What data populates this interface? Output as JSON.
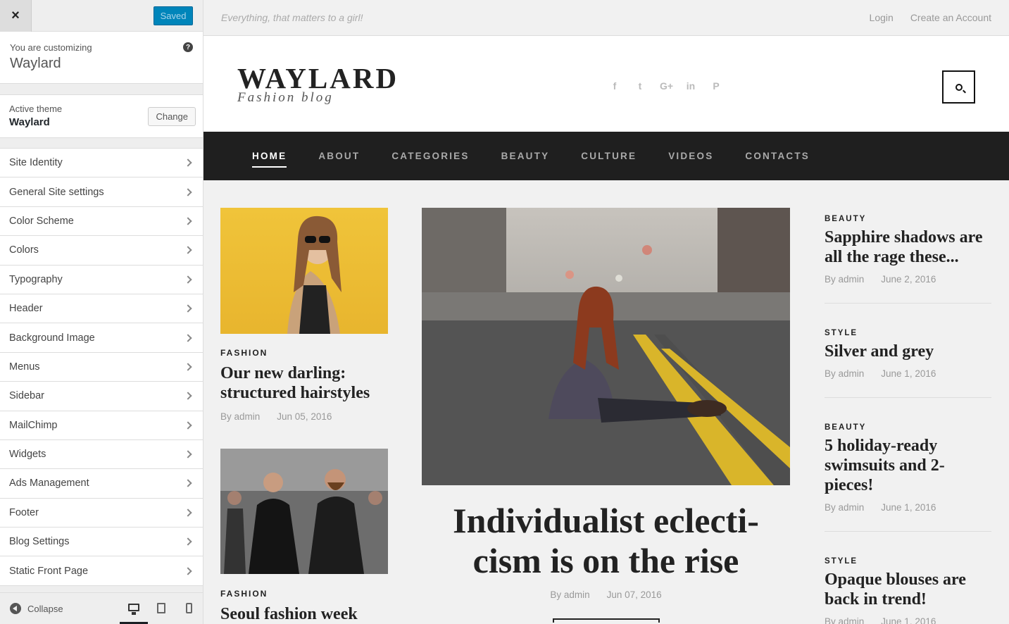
{
  "sidebar": {
    "close_label": "×",
    "saved_label": "Saved",
    "customizing_label": "You are customizing",
    "site_name": "Waylard",
    "help_label": "?",
    "active_theme_label": "Active theme",
    "active_theme_name": "Waylard",
    "change_label": "Change",
    "items": [
      {
        "label": "Site Identity"
      },
      {
        "label": "General Site settings"
      },
      {
        "label": "Color Scheme"
      },
      {
        "label": "Colors"
      },
      {
        "label": "Typography"
      },
      {
        "label": "Header"
      },
      {
        "label": "Background Image"
      },
      {
        "label": "Menus"
      },
      {
        "label": "Sidebar"
      },
      {
        "label": "MailChimp"
      },
      {
        "label": "Widgets"
      },
      {
        "label": "Ads Management"
      },
      {
        "label": "Footer"
      },
      {
        "label": "Blog Settings"
      },
      {
        "label": "Static Front Page"
      }
    ],
    "collapse_label": "Collapse",
    "devices": [
      "desktop-icon",
      "tablet-icon",
      "mobile-icon"
    ],
    "active_device": "desktop"
  },
  "site": {
    "tagline": "Everything, that matters to a girl!",
    "login": "Login",
    "create_account": "Create an Account",
    "logo": "WAYLARD",
    "logo_sub": "Fashion blog",
    "socials": [
      {
        "icon": "facebook-icon",
        "glyph": "f"
      },
      {
        "icon": "twitter-icon",
        "glyph": "t"
      },
      {
        "icon": "google-plus-icon",
        "glyph": "G+"
      },
      {
        "icon": "linkedin-icon",
        "glyph": "in"
      },
      {
        "icon": "pinterest-icon",
        "glyph": "P"
      }
    ],
    "nav": [
      {
        "label": "HOME",
        "active": true
      },
      {
        "label": "ABOUT"
      },
      {
        "label": "CATEGORIES"
      },
      {
        "label": "BEAUTY"
      },
      {
        "label": "CULTURE"
      },
      {
        "label": "VIDEOS"
      },
      {
        "label": "CONTACTS"
      }
    ]
  },
  "left_posts": [
    {
      "category": "FASHION",
      "title": "Our new darling: structured hairstyles",
      "author": "By admin",
      "date": "Jun 05, 2016"
    },
    {
      "category": "FASHION",
      "title": "Seoul fashion week"
    }
  ],
  "featured": {
    "title": "Individualist eclecti-cism is on the rise",
    "author": "By admin",
    "date": "Jun 07, 2016"
  },
  "right_posts": [
    {
      "category": "BEAUTY",
      "title": "Sapphire shadows are all the rage these...",
      "author": "By admin",
      "date": "June 2, 2016"
    },
    {
      "category": "STYLE",
      "title": "Silver and grey",
      "author": "By admin",
      "date": "June 1, 2016"
    },
    {
      "category": "BEAUTY",
      "title": "5 holiday-ready swimsuits and 2-pieces!",
      "author": "By admin",
      "date": "June 1, 2016"
    },
    {
      "category": "STYLE",
      "title": "Opaque blouses are back in trend!",
      "author": "By admin",
      "date": "June 1, 2016"
    }
  ],
  "colors": {
    "saved_button": "#0085ba",
    "nav_background": "#1f1f1f",
    "thumb_yellow": "#f0c43a"
  }
}
